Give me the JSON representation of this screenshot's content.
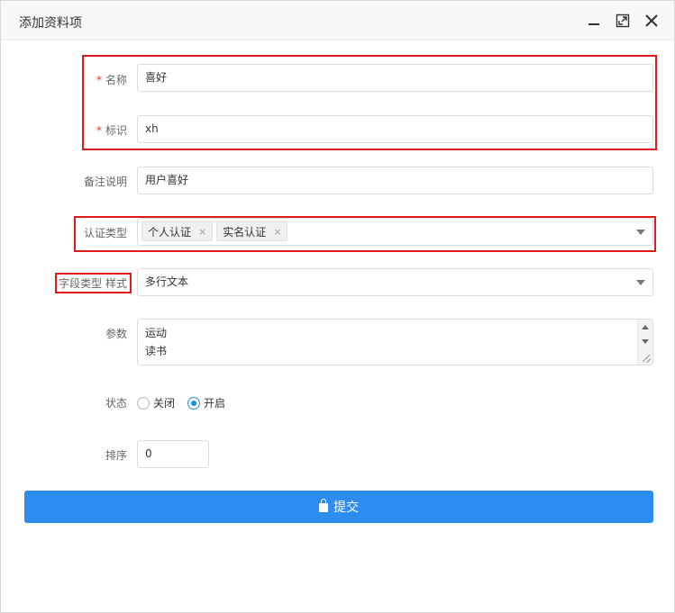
{
  "dialog": {
    "title": "添加资料项"
  },
  "titlebar_icons": [
    "minimize-icon",
    "maximize-icon",
    "close-icon"
  ],
  "form": {
    "name": {
      "label": "名称",
      "required": "*",
      "value": "喜好"
    },
    "identifier": {
      "label": "标识",
      "required": "*",
      "value": "xh"
    },
    "remark": {
      "label": "备注说明",
      "value": "用户喜好"
    },
    "auth_type": {
      "label": "认证类型",
      "tags": [
        {
          "text": "个人认证",
          "remove": "×"
        },
        {
          "text": "实名认证",
          "remove": "×"
        }
      ]
    },
    "field_type": {
      "label": "字段类型 样式",
      "value": "多行文本"
    },
    "params": {
      "label": "参数",
      "lines": [
        "运动",
        "读书"
      ]
    },
    "status": {
      "label": "状态",
      "options": [
        "关闭",
        "开启"
      ],
      "selected": "开启"
    },
    "sort": {
      "label": "排序",
      "value": "0"
    }
  },
  "submit": {
    "label": "提交"
  },
  "colors": {
    "primary": "#2d8cf0",
    "highlight": "#e01b1b",
    "required": "#e62c2c"
  }
}
